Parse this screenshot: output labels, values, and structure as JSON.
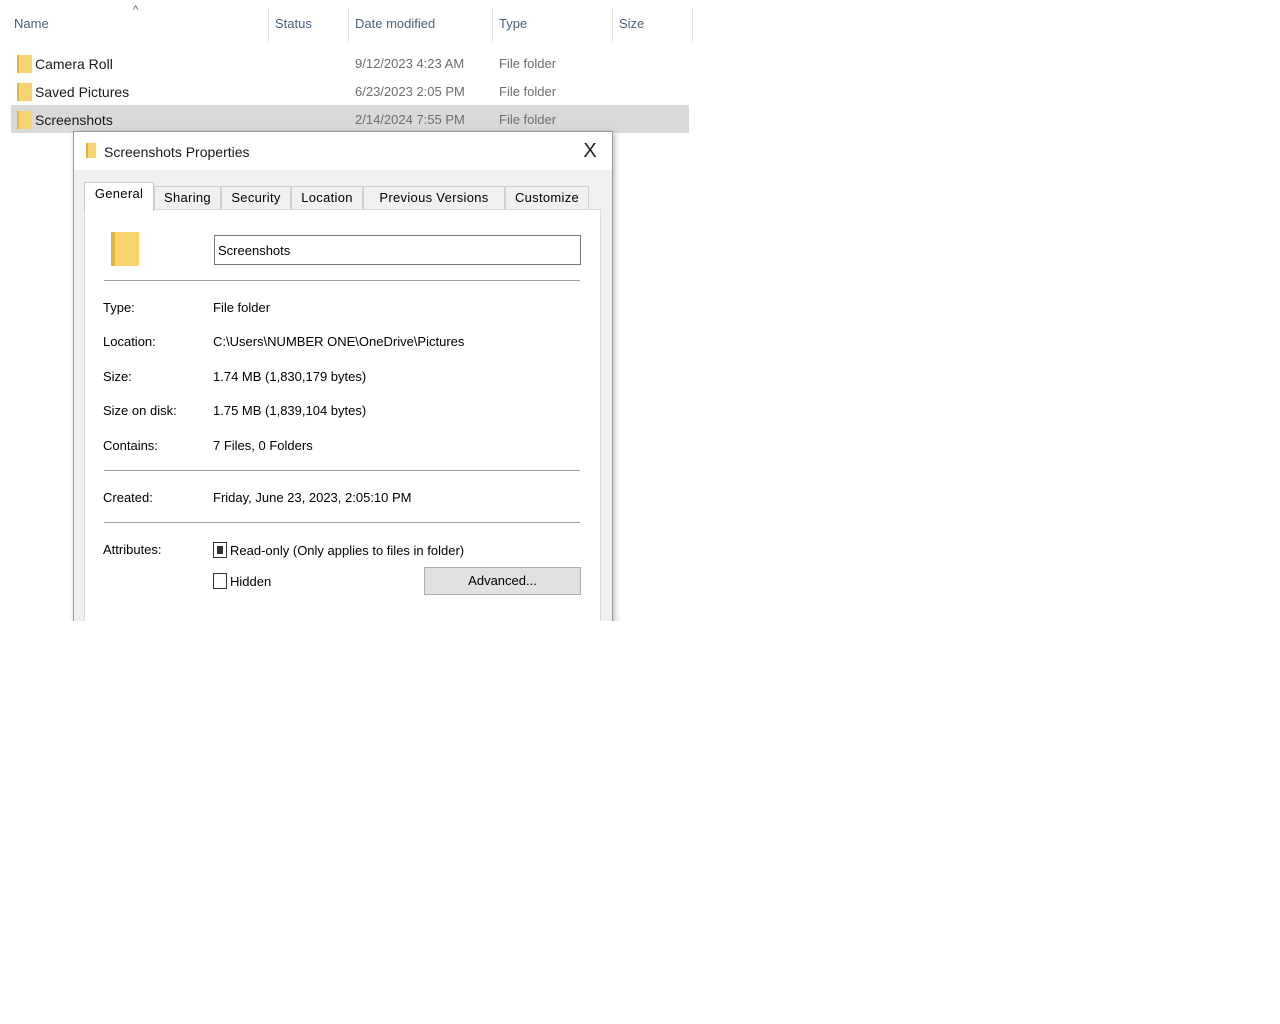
{
  "explorer": {
    "columns": {
      "name": "Name",
      "status": "Status",
      "date_modified": "Date modified",
      "type": "Type",
      "size": "Size"
    },
    "sort_indicator": "^",
    "rows": [
      {
        "name": "Camera Roll",
        "date": "9/12/2023 4:23 AM",
        "type": "File folder"
      },
      {
        "name": "Saved Pictures",
        "date": "6/23/2023 2:05 PM",
        "type": "File folder"
      },
      {
        "name": "Screenshots",
        "date": "2/14/2024 7:55 PM",
        "type": "File folder"
      }
    ]
  },
  "dialog": {
    "title": "Screenshots Properties",
    "close": "X",
    "tabs": [
      "General",
      "Sharing",
      "Security",
      "Location",
      "Previous Versions",
      "Customize"
    ],
    "folder_name": "Screenshots",
    "type_label": "Type:",
    "type_value": "File folder",
    "location_label": "Location:",
    "location_value": "C:\\Users\\NUMBER ONE\\OneDrive\\Pictures",
    "size_label": "Size:",
    "size_value": "1.74 MB (1,830,179 bytes)",
    "size_on_disk_label": "Size on disk:",
    "size_on_disk_value": "1.75 MB (1,839,104 bytes)",
    "contains_label": "Contains:",
    "contains_value": "7 Files, 0 Folders",
    "created_label": "Created:",
    "created_value": "Friday, June 23, 2023, 2:05:10 PM",
    "attributes_label": "Attributes:",
    "readonly_label": "Read-only (Only applies to files in folder)",
    "hidden_label": "Hidden",
    "advanced_button": "Advanced..."
  }
}
